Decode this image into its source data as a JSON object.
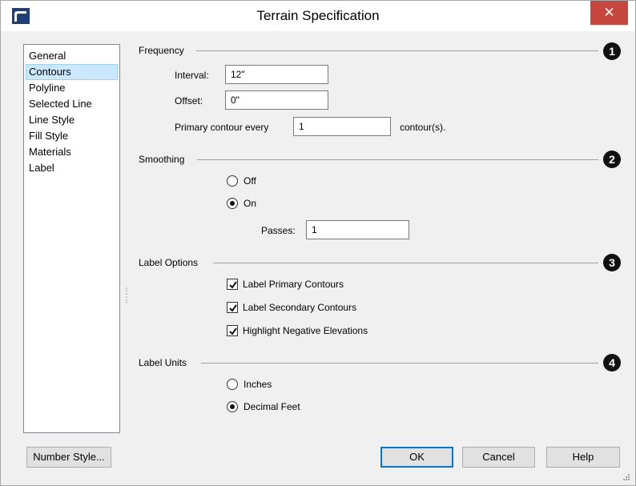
{
  "window": {
    "title": "Terrain Specification",
    "close_label": "✕",
    "icon": "app-logo-icon"
  },
  "sidebar": {
    "items": [
      {
        "label": "General",
        "selected": false
      },
      {
        "label": "Contours",
        "selected": true
      },
      {
        "label": "Polyline",
        "selected": false
      },
      {
        "label": "Selected Line",
        "selected": false
      },
      {
        "label": "Line Style",
        "selected": false
      },
      {
        "label": "Fill Style",
        "selected": false
      },
      {
        "label": "Materials",
        "selected": false
      },
      {
        "label": "Label",
        "selected": false
      }
    ]
  },
  "frequency": {
    "heading": "Frequency",
    "badge": "1",
    "interval_label": "Interval:",
    "interval_value": "12\"",
    "offset_label": "Offset:",
    "offset_value": "0\"",
    "primary_label": "Primary contour every",
    "primary_value": "1",
    "primary_suffix": "contour(s)."
  },
  "smoothing": {
    "heading": "Smoothing",
    "badge": "2",
    "off_label": "Off",
    "on_label": "On",
    "selected": "On",
    "passes_label": "Passes:",
    "passes_value": "1"
  },
  "label_options": {
    "heading": "Label Options",
    "badge": "3",
    "primary_label": "Label Primary Contours",
    "primary_checked": true,
    "secondary_label": "Label Secondary Contours",
    "secondary_checked": true,
    "negative_label": "Highlight Negative Elevations",
    "negative_checked": true
  },
  "label_units": {
    "heading": "Label Units",
    "badge": "4",
    "inches_label": "Inches",
    "decimal_label": "Decimal Feet",
    "selected": "Decimal Feet"
  },
  "buttons": {
    "number_style": "Number Style...",
    "ok": "OK",
    "cancel": "Cancel",
    "help": "Help"
  },
  "colors": {
    "close_button": "#c7463d",
    "selection": "#cce8ff",
    "default_button_border": "#0078d7"
  }
}
